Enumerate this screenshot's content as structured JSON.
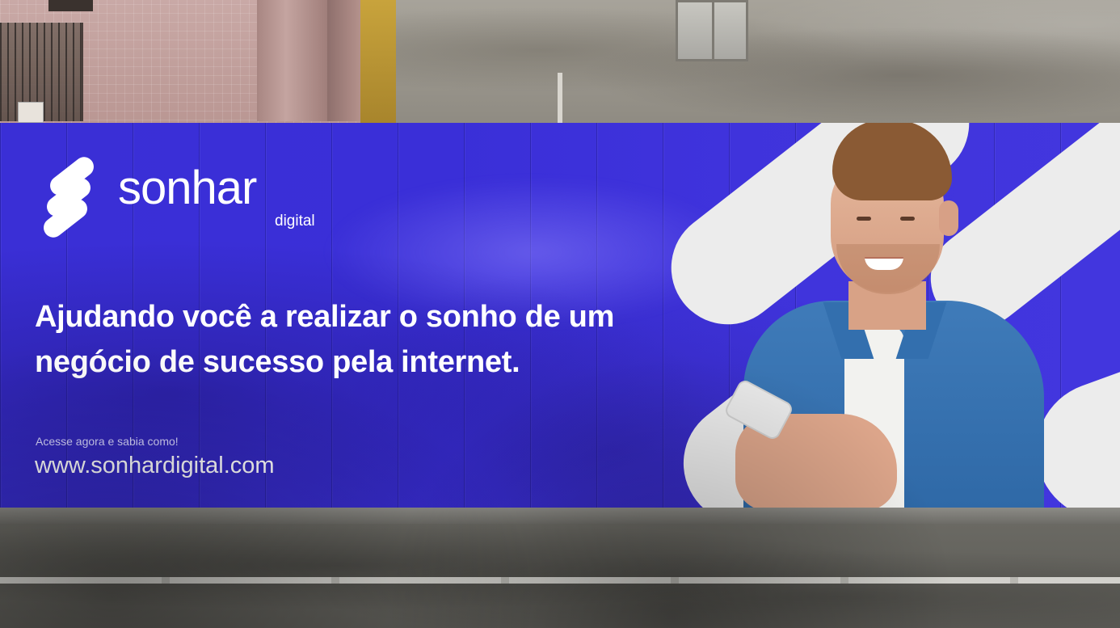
{
  "billboard": {
    "brand_name": "sonhar",
    "brand_sub": "digital",
    "headline": "Ajudando você a realizar o sonho de um negócio de sucesso pela internet.",
    "cta": "Acesse agora e sabia como!",
    "url": "www.sonhardigital.com"
  },
  "colors": {
    "brand_blue": "#3a2fd8",
    "stripe_white": "#ececec",
    "text_white": "#ffffff"
  }
}
